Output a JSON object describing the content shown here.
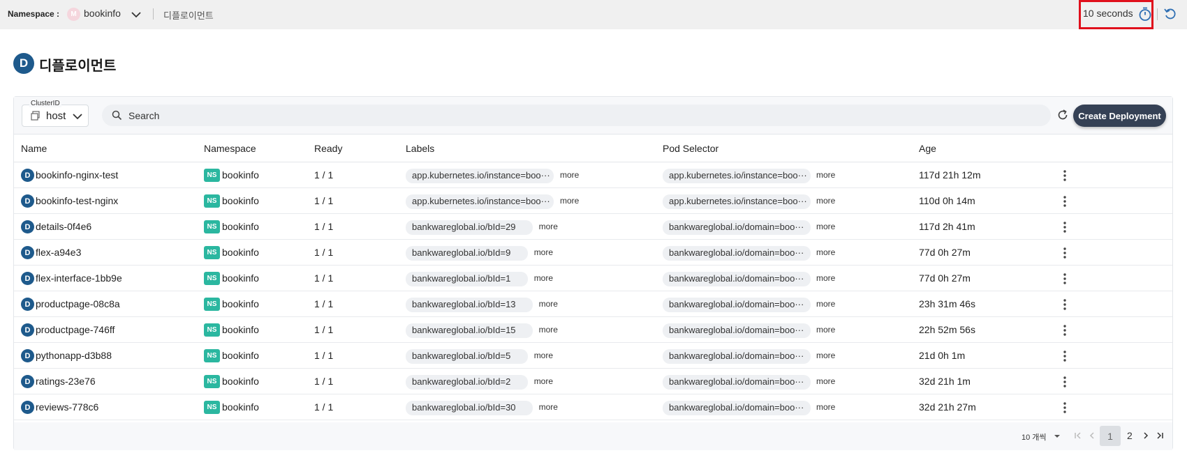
{
  "topbar": {
    "namespace_label": "Namespace :",
    "namespace_avatar": "M",
    "namespace_value": "bookinfo",
    "breadcrumb": "디플로이먼트",
    "refresh_interval": "10 seconds"
  },
  "page": {
    "title_badge": "D",
    "title": "디플로이먼트"
  },
  "toolbar": {
    "cluster_legend": "ClusterID",
    "cluster_value": "host",
    "search_placeholder": "Search",
    "create_label": "Create Deployment"
  },
  "table": {
    "columns": {
      "name": "Name",
      "namespace": "Namespace",
      "ready": "Ready",
      "labels": "Labels",
      "pod_selector": "Pod Selector",
      "age": "Age"
    },
    "row_badge": "D",
    "ns_badge": "NS",
    "more_label": "more",
    "rows": [
      {
        "name": "bookinfo-nginx-test",
        "namespace": "bookinfo",
        "ready": "1 / 1",
        "label": "app.kubernetes.io/instance=boo···",
        "selector": "app.kubernetes.io/instance=boo···",
        "age": "117d 21h 12m"
      },
      {
        "name": "bookinfo-test-nginx",
        "namespace": "bookinfo",
        "ready": "1 / 1",
        "label": "app.kubernetes.io/instance=boo···",
        "selector": "app.kubernetes.io/instance=boo···",
        "age": "110d 0h 14m"
      },
      {
        "name": "details-0f4e6",
        "namespace": "bookinfo",
        "ready": "1 / 1",
        "label": "bankwareglobal.io/bId=29",
        "selector": "bankwareglobal.io/domain=boo···",
        "age": "117d 2h 41m"
      },
      {
        "name": "flex-a94e3",
        "namespace": "bookinfo",
        "ready": "1 / 1",
        "label": "bankwareglobal.io/bId=9",
        "selector": "bankwareglobal.io/domain=boo···",
        "age": "77d 0h 27m"
      },
      {
        "name": "flex-interface-1bb9e",
        "namespace": "bookinfo",
        "ready": "1 / 1",
        "label": "bankwareglobal.io/bId=1",
        "selector": "bankwareglobal.io/domain=boo···",
        "age": "77d 0h 27m"
      },
      {
        "name": "productpage-08c8a",
        "namespace": "bookinfo",
        "ready": "1 / 1",
        "label": "bankwareglobal.io/bId=13",
        "selector": "bankwareglobal.io/domain=boo···",
        "age": "23h 31m 46s"
      },
      {
        "name": "productpage-746ff",
        "namespace": "bookinfo",
        "ready": "1 / 1",
        "label": "bankwareglobal.io/bId=15",
        "selector": "bankwareglobal.io/domain=boo···",
        "age": "22h 52m 56s"
      },
      {
        "name": "pythonapp-d3b88",
        "namespace": "bookinfo",
        "ready": "1 / 1",
        "label": "bankwareglobal.io/bId=5",
        "selector": "bankwareglobal.io/domain=boo···",
        "age": "21d 0h 1m"
      },
      {
        "name": "ratings-23e76",
        "namespace": "bookinfo",
        "ready": "1 / 1",
        "label": "bankwareglobal.io/bId=2",
        "selector": "bankwareglobal.io/domain=boo···",
        "age": "32d 21h 1m"
      },
      {
        "name": "reviews-778c6",
        "namespace": "bookinfo",
        "ready": "1 / 1",
        "label": "bankwareglobal.io/bId=30",
        "selector": "bankwareglobal.io/domain=boo···",
        "age": "32d 21h 27m"
      }
    ]
  },
  "pagination": {
    "page_size": "10 개씩",
    "current_page": "1",
    "next_page": "2"
  },
  "colors": {
    "primary_badge": "#1e5a8c",
    "namespace_badge": "#2bb7a0",
    "create_button": "#354155",
    "highlight_box": "#e0101c"
  },
  "icons": [
    "chevron-down-icon",
    "timer-icon",
    "undo-icon",
    "cluster-icon",
    "search-icon",
    "reload-icon",
    "kebab-icon",
    "first-page-icon",
    "prev-page-icon",
    "next-page-icon",
    "last-page-icon"
  ]
}
